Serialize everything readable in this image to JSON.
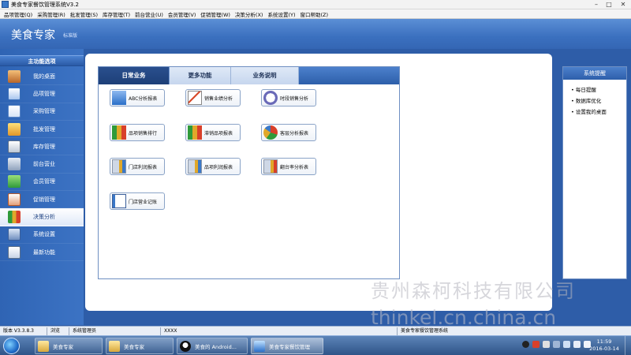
{
  "window": {
    "title": "美食专家餐饮管理系统V3.2",
    "minimize": "–",
    "maximize": "□",
    "close": "✕"
  },
  "menu": [
    "品项管理(Q)",
    "采购管理(R)",
    "批发管理(S)",
    "库存管理(T)",
    "前台营业(U)",
    "会员管理(V)",
    "促销管理(W)",
    "决策分析(X)",
    "系统设置(Y)",
    "窗口帮助(Z)"
  ],
  "header": {
    "brand": "美食专家",
    "edition": "标准版"
  },
  "sidebar": {
    "title": "主功能选项",
    "items": [
      {
        "label": "我的桌面",
        "icon": "home-icon"
      },
      {
        "label": "品项管理",
        "icon": "items-icon"
      },
      {
        "label": "采购管理",
        "icon": "purchase-icon"
      },
      {
        "label": "批发管理",
        "icon": "wholesale-icon"
      },
      {
        "label": "库存管理",
        "icon": "inventory-icon"
      },
      {
        "label": "前台营业",
        "icon": "cart-icon"
      },
      {
        "label": "会员管理",
        "icon": "members-icon"
      },
      {
        "label": "促销管理",
        "icon": "promotion-icon"
      },
      {
        "label": "决策分析",
        "icon": "bar-chart-icon",
        "active": true
      },
      {
        "label": "系统设置",
        "icon": "settings-icon"
      },
      {
        "label": "最新功能",
        "icon": "new-features-icon"
      }
    ]
  },
  "tabs": [
    "日常业务",
    "更多功能",
    "业务说明"
  ],
  "functions": [
    {
      "label": "ABC分析报表",
      "icon": "abc-check-icon"
    },
    {
      "label": "销售业绩分析",
      "icon": "trend-icon"
    },
    {
      "label": "时段销售分析",
      "icon": "clock-icon"
    },
    {
      "label": "品项销售排行",
      "icon": "bar-chart-icon"
    },
    {
      "label": "滞销品项报表",
      "icon": "bar-chart-icon"
    },
    {
      "label": "客层分析报表",
      "icon": "pie-chart-icon"
    },
    {
      "label": "门店利润报表",
      "icon": "report-chart-icon"
    },
    {
      "label": "品项利润报表",
      "icon": "report-chart-icon"
    },
    {
      "label": "翻台率分析表",
      "icon": "report-chart-icon"
    },
    {
      "label": "门店营业记账",
      "icon": "ledger-icon"
    }
  ],
  "reminder": {
    "title": "系统提醒",
    "items": [
      "每日提醒",
      "数据库优化",
      "设置我的桌面"
    ]
  },
  "watermark": {
    "company": "贵州森柯科技有限公司",
    "site": "thinkel.cn.china.cn"
  },
  "statusbar": [
    "版本 V3.3.8.3",
    "浏览",
    "系统管理员",
    "XXXX",
    "美食专家餐饮管理系统"
  ],
  "taskbar": {
    "items": [
      {
        "label": "美食专家",
        "icon": "folder-icon"
      },
      {
        "label": "美食专家",
        "icon": "folder-icon"
      },
      {
        "label": "美食的 Android...",
        "icon": "qq-icon"
      },
      {
        "label": "美食专家餐饮管理",
        "icon": "app-window-icon",
        "active": true
      }
    ],
    "time": "11:59",
    "date": "2016-03-14"
  },
  "colors": {
    "header": "#3b70bf",
    "sidebar": "#2f64b4",
    "tab_active": "#1d3f78",
    "panel_border": "#6e8fc2"
  }
}
